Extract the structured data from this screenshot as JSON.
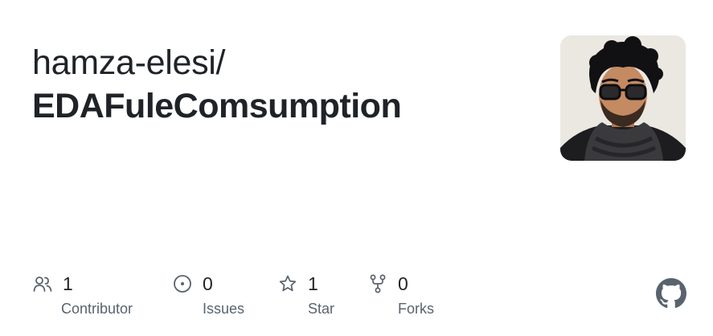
{
  "header": {
    "owner": "hamza-elesi/",
    "repo": "EDAFuleComsumption"
  },
  "avatar": {
    "icon": "avatar-illustration"
  },
  "stats": {
    "contributors": {
      "count": "1",
      "label": "Contributor",
      "icon": "people-icon"
    },
    "issues": {
      "count": "0",
      "label": "Issues",
      "icon": "issue-opened-icon"
    },
    "stars": {
      "count": "1",
      "label": "Star",
      "icon": "star-icon"
    },
    "forks": {
      "count": "0",
      "label": "Forks",
      "icon": "repo-forked-icon"
    }
  },
  "brand": {
    "icon": "github-mark-icon",
    "color": "#59636e"
  }
}
